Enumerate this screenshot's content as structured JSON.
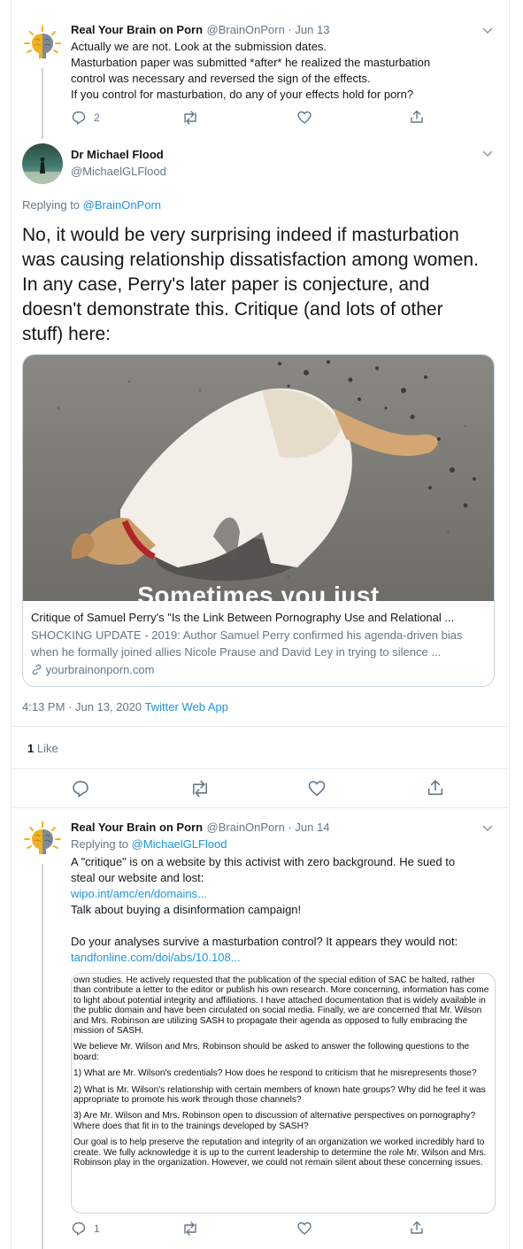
{
  "tweet1": {
    "display_name": "Real Your Brain on Porn",
    "handle_date": "@BrainOnPorn · Jun 13",
    "lines": [
      "Actually we are not. Look at the submission dates.",
      "Masturbation paper was submitted *after* he realized the masturbation",
      "control was necessary and reversed the sign of the effects.",
      "If you control for masturbation, do any of your effects hold for porn?"
    ],
    "reply_count": "2",
    "icons": [
      "reply-icon",
      "retweet-icon",
      "like-icon",
      "share-icon"
    ]
  },
  "main_tweet": {
    "display_name": "Dr Michael Flood",
    "handle": "@MichaelGLFlood",
    "replying_prefix": "Replying to",
    "replying_to": "@BrainOnPorn",
    "text_lines": [
      "No, it would be very surprising indeed if masturbation",
      "was causing relationship dissatisfaction among women.",
      "In any case, Perry's later paper is conjecture, and",
      "doesn't demonstrate this. Critique (and lots of other",
      "stuff) here:"
    ],
    "card": {
      "image_caption": "Sometimes you just",
      "title": "Critique of Samuel Perry's \"Is the Link Between Pornography Use and Relational ...",
      "description": "SHOCKING UPDATE - 2019: Author Samuel Perry confirmed his agenda-driven bias",
      "description2": "when he formally joined allies Nicole Prause and David Ley in trying to silence ...",
      "domain": "yourbrainonporn.com"
    },
    "time": "4:13 PM · Jun 13, 2020",
    "source": "Twitter Web App",
    "likes_count": "1",
    "likes_label": "Like"
  },
  "tweet3": {
    "display_name": "Real Your Brain on Porn",
    "handle_date": "@BrainOnPorn · Jun 14",
    "replying_prefix": "Replying to",
    "replying_to": "@MichaelGLFlood",
    "line1": "A \"critique\" is on a website by this activist with zero background. He sued to",
    "line2": "steal our website and lost:",
    "link1": "wipo.int/amc/en/domains...",
    "line3": "Talk about buying a disinformation campaign!",
    "line4": "Do your analyses survive a masturbation control? It appears they would not:",
    "link2": "tandfonline.com/doi/abs/10.108...",
    "reply_count": "1",
    "document": {
      "p1": "own studies. He actively requested that the publication of the special edition of SAC be halted, rather than contribute a letter to the editor or publish his own research. More concerning, information has come to light about potential integrity and affiliations. I have attached documentation that is widely available in the public domain and have been circulated on social media. Finally, we are concerned that Mr. Wilson and Mrs. Robinson are utilizing SASH to propagate their agenda as opposed to fully embracing the mission of SASH.",
      "p2": "We believe Mr. Wilson and Mrs. Robinson should be asked to answer the following questions to the board:",
      "p3": "1) What are Mr. Wilson's credentials? How does he respond to criticism that he misrepresents those?",
      "p4": "2) What is Mr. Wilson's relationship with certain members of known hate groups? Why did he feel it was appropriate to promote his work through those channels?",
      "p5": "3) Are Mr. Wilson and Mrs. Robinson open to discussion of alternative perspectives on pornography? Where does that fit in to the trainings developed by SASH?",
      "p6": "Our goal is to help preserve the reputation and integrity of an organization we worked incredibly hard to create. We fully acknowledge it is up to the current leadership to determine the role Mr. Wilson and Mrs. Robinson play in the organization. However, we could not remain silent about these concerning issues."
    }
  },
  "colors": {
    "link": "#1b95e0",
    "secondary_text": "#657786",
    "border": "#e6ecf0"
  }
}
